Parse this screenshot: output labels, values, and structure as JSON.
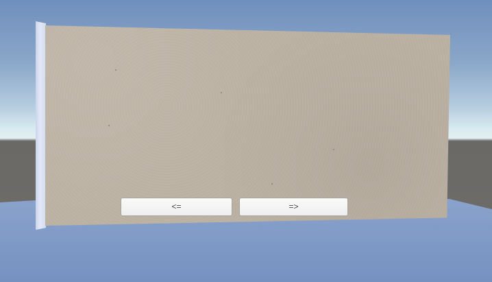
{
  "navigation": {
    "prev_label": "<=",
    "next_label": "=>"
  },
  "colors": {
    "panel": "#bdb3a5",
    "sky_top": "#6f8fbd",
    "horizon": "#e3f0f3",
    "ground": "#6b6966",
    "floor": "#7f98c4",
    "button_bg": "#f6f6f6"
  }
}
